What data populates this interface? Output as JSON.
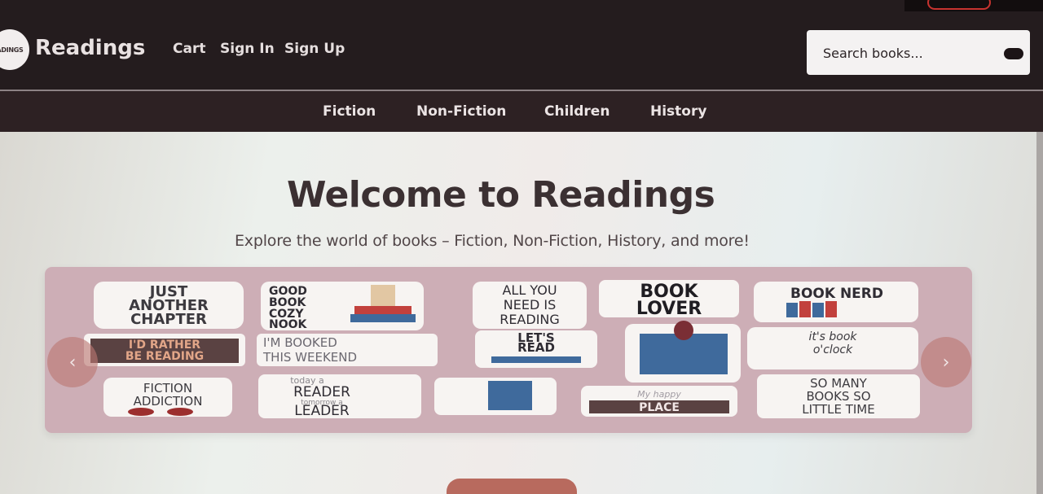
{
  "brand": {
    "logo_text": "ADINGS",
    "name": "Readings"
  },
  "nav": {
    "cart": "Cart",
    "sign_in": "Sign In",
    "sign_up": "Sign Up"
  },
  "search": {
    "placeholder": "Search books..."
  },
  "categories": [
    "Fiction",
    "Non-Fiction",
    "Children",
    "History"
  ],
  "hero": {
    "title": "Welcome to Readings",
    "subtitle": "Explore the world of books – Fiction, Non-Fiction, History, and more!"
  },
  "carousel": {
    "stickers": [
      {
        "line1": "JUST",
        "line2": "ANOTHER",
        "line3": "CHAPTER"
      },
      {
        "line1": "GOOD",
        "line2": "BOOK",
        "line3": "COZY",
        "line4": "NOOK"
      },
      {
        "line1": "ALL YOU",
        "line2": "NEED IS",
        "line3": "READING"
      },
      {
        "line1": "BOOK",
        "line2": "LOVER"
      },
      {
        "line1": "BOOK NERD"
      },
      {
        "line1": "I'D RATHER",
        "line2": "BE READING"
      },
      {
        "line1": "I'M BOOKED",
        "line2": "THIS WEEKEND"
      },
      {
        "line1": "LET'S",
        "line2": "READ"
      },
      {
        "line1": "it's book",
        "line2": "o'clock"
      },
      {
        "line1": "FICTION",
        "line2": "ADDICTION"
      },
      {
        "line1": "today a",
        "line2": "READER",
        "line3": "tomorrow a",
        "line4": "LEADER"
      },
      {
        "line1": "My happy",
        "line2": "PLACE"
      },
      {
        "line1": "SO MANY",
        "line2": "BOOKS SO",
        "line3": "LITTLE TIME"
      }
    ],
    "prev_glyph": "‹",
    "next_glyph": "›"
  },
  "colors": {
    "header_bg": "#241c1e",
    "category_bg": "#2d2123",
    "carousel_bg": "#cdaeb6",
    "accent": "#b86a5e"
  },
  "icons": {
    "search": "search-icon",
    "prev": "chevron-left-icon",
    "next": "chevron-right-icon"
  }
}
